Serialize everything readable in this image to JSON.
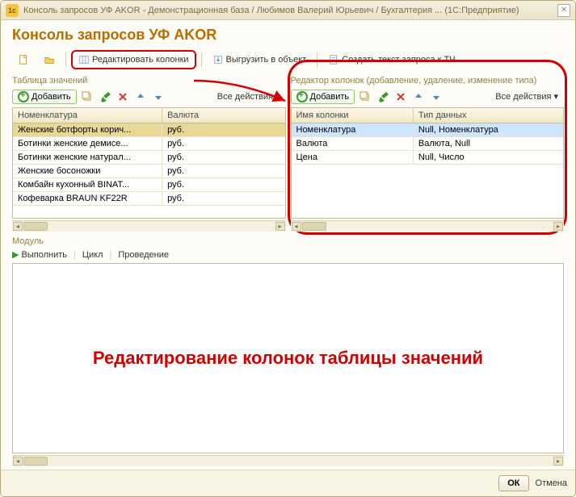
{
  "titlebar": "Консоль запросов УФ AKOR - Демонстрационная база / Любимов Валерий Юрьевич / Бухгалтерия ...   (1С:Предприятие)",
  "heading": "Консоль запросов УФ AKOR",
  "toolbar": {
    "edit_columns": "Редактировать колонки",
    "export_object": "Выгрузить в объект",
    "create_query_text": "Создать текст запроса к ТЧ"
  },
  "left": {
    "group_label": "Таблица значений",
    "add": "Добавить",
    "all_actions": "Все действия",
    "columns": {
      "c1": "Номенклатура",
      "c2": "Валюта"
    },
    "rows": [
      {
        "c1": "Женские ботфорты корич...",
        "c2": "руб."
      },
      {
        "c1": "Ботинки женские демисе...",
        "c2": "руб."
      },
      {
        "c1": "Ботинки женские натурал...",
        "c2": "руб."
      },
      {
        "c1": "Женские босоножки",
        "c2": "руб."
      },
      {
        "c1": "Комбайн кухонный BINAT...",
        "c2": "руб."
      },
      {
        "c1": "Кофеварка BRAUN KF22R",
        "c2": "руб."
      }
    ]
  },
  "right": {
    "group_label": "Редактор колонок (добавление, удаление, изменение типа)",
    "add": "Добавить",
    "all_actions": "Все действия",
    "columns": {
      "c1": "Имя колонки",
      "c2": "Тип данных"
    },
    "rows": [
      {
        "c1": "Номенклатура",
        "c2": "Null, Номенклатура"
      },
      {
        "c1": "Валюта",
        "c2": "Валюта, Null"
      },
      {
        "c1": "Цена",
        "c2": "Null, Число"
      }
    ]
  },
  "module": {
    "label": "Модуль",
    "run": "Выполнить",
    "loop": "Цикл",
    "posting": "Проведение"
  },
  "overlay": "Редактирование колонок таблицы значений",
  "footer": {
    "ok": "ОК",
    "cancel": "Отмена"
  }
}
